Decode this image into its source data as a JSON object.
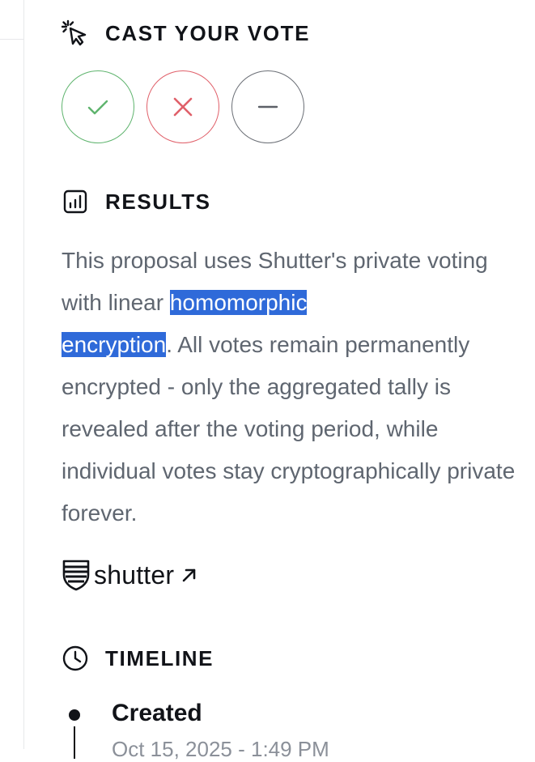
{
  "vote": {
    "heading": "CAST YOUR VOTE",
    "icon": "pointer-click-icon",
    "options": [
      {
        "name": "yes",
        "icon": "check-icon",
        "color": "#5fb46e"
      },
      {
        "name": "no",
        "icon": "x-icon",
        "color": "#e0606a"
      },
      {
        "name": "abstain",
        "icon": "minus-icon",
        "color": "#6b6f76"
      }
    ]
  },
  "results": {
    "heading": "RESULTS",
    "icon": "bar-chart-icon",
    "text_before": "This proposal uses Shutter's private voting with linear ",
    "highlight_1": "homomorphic",
    "highlight_2": "encryption",
    "text_after": ". All votes remain permanently encrypted - only the aggregated tally is revealed after the voting period, while individual votes stay cryptographically private forever.",
    "highlight_color": "#2f6ad9"
  },
  "shutter": {
    "label": "shutter",
    "icon": "shutter-shield-icon",
    "link_icon": "arrow-up-right-icon"
  },
  "timeline": {
    "heading": "TIMELINE",
    "icon": "clock-icon",
    "items": [
      {
        "label": "Created",
        "date": "Oct 15, 2025 - 1:49 PM"
      }
    ]
  }
}
